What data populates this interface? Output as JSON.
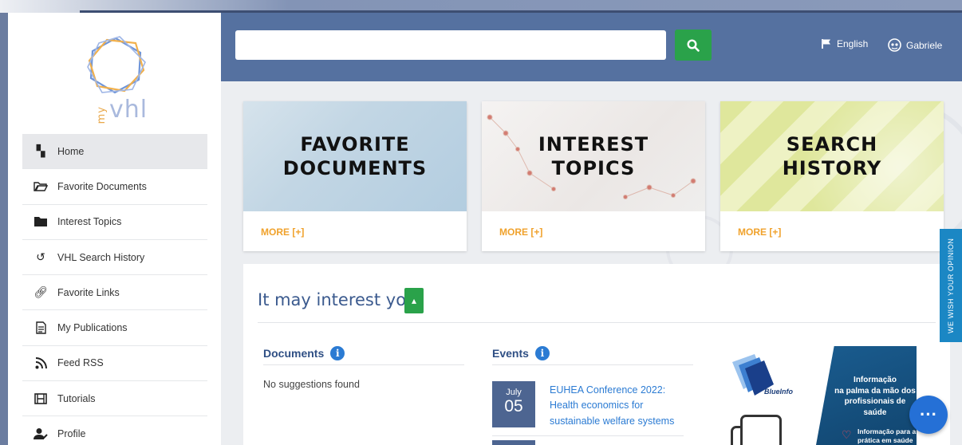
{
  "header": {
    "language_label": "English",
    "user_label": "Gabriele",
    "search_value": ""
  },
  "logo": {
    "prefix": "my",
    "text": "vhl"
  },
  "sidebar": {
    "items": [
      {
        "label": "Home",
        "icon": "home-icon"
      },
      {
        "label": "Favorite Documents",
        "icon": "folder-open-icon"
      },
      {
        "label": "Interest Topics",
        "icon": "folder-icon"
      },
      {
        "label": "VHL Search History",
        "icon": "history-icon"
      },
      {
        "label": "Favorite Links",
        "icon": "link-icon"
      },
      {
        "label": "My Publications",
        "icon": "document-icon"
      },
      {
        "label": "Feed RSS",
        "icon": "rss-icon"
      },
      {
        "label": "Tutorials",
        "icon": "film-icon"
      },
      {
        "label": "Profile",
        "icon": "user-edit-icon"
      }
    ]
  },
  "cards": [
    {
      "title_line1": "FAVORITE",
      "title_line2": "DOCUMENTS",
      "more": "MORE [+]"
    },
    {
      "title_line1": "INTEREST",
      "title_line2": "TOPICS",
      "more": "MORE [+]"
    },
    {
      "title_line1": "SEARCH",
      "title_line2": "HISTORY",
      "more": "MORE [+]"
    }
  ],
  "interest": {
    "heading": "It may interest you",
    "documents_heading": "Documents",
    "no_suggestions": "No suggestions found",
    "events_heading": "Events",
    "event": {
      "month": "July",
      "day": "05",
      "title": "EUHEA Conference 2022: Health economics for sustainable welfare systems"
    }
  },
  "ad": {
    "brand": "BlueInfo",
    "headline_1": "Informação",
    "headline_2": "na palma da mão dos",
    "headline_3": "profissionais de saúde",
    "sub_1": "Informação para a",
    "sub_2": "prática em saúde"
  },
  "side_tab": "WE WISH YOUR OPINION",
  "colors": {
    "header": "#5571a0",
    "accent_green": "#2aa24a",
    "more_orange": "#f0a22c",
    "link_blue": "#2b7bd3",
    "side_tab": "#1b87c4"
  }
}
